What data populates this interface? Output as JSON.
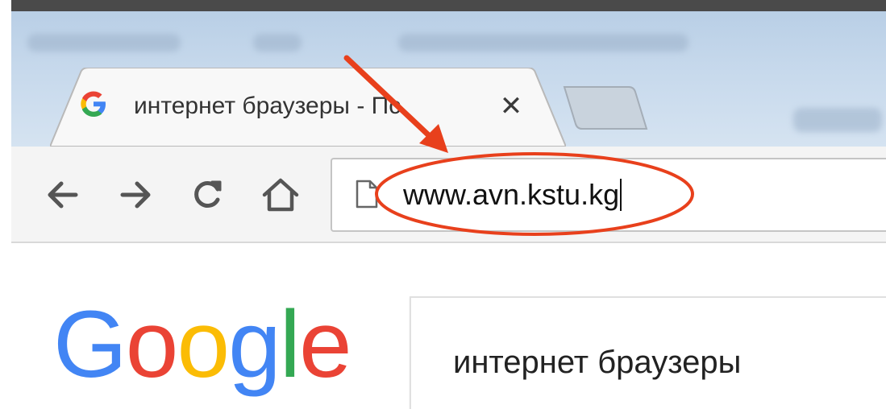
{
  "tab": {
    "favicon_letter": "G",
    "title": "интернет браузеры - Пс",
    "close_label": "✕"
  },
  "toolbar": {
    "back_icon": "arrow-left-icon",
    "forward_icon": "arrow-right-icon",
    "reload_icon": "reload-icon",
    "home_icon": "home-icon"
  },
  "omnibox": {
    "url": "www.avn.kstu.kg"
  },
  "page": {
    "logo": [
      "G",
      "o",
      "o",
      "g",
      "l",
      "e"
    ],
    "search_query": "интернет браузеры"
  },
  "colors": {
    "google_blue": "#4285F4",
    "google_red": "#EA4335",
    "google_yellow": "#FBBC05",
    "google_green": "#34A853",
    "annotation_red": "#e8401c"
  }
}
